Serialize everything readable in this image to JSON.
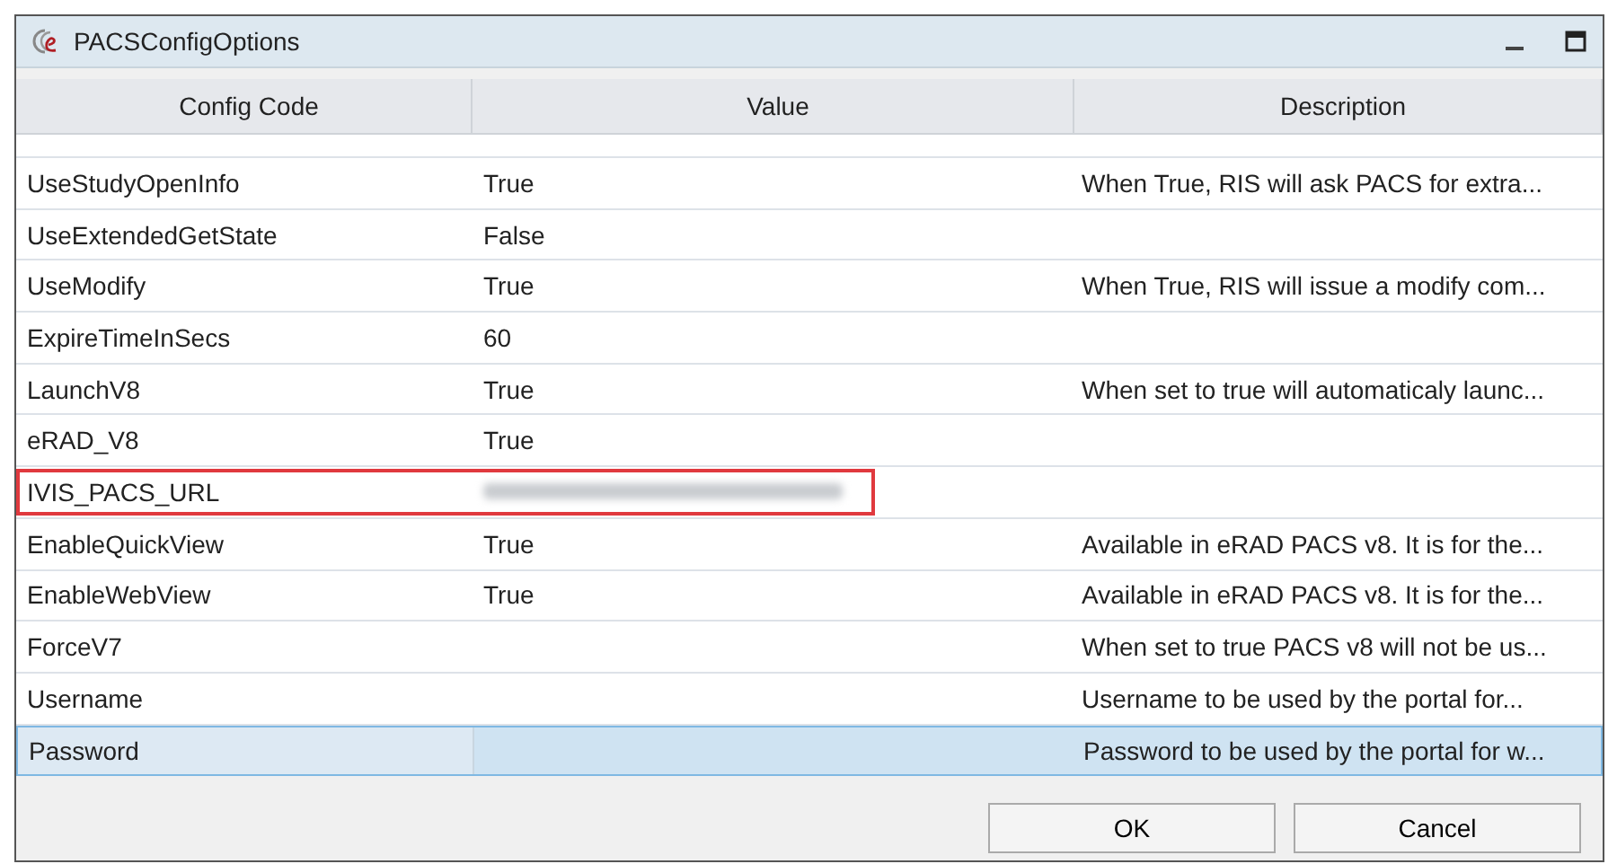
{
  "window": {
    "title": "PACSConfigOptions"
  },
  "table": {
    "columns": [
      "Config Code",
      "Value",
      "Description"
    ],
    "rows": [
      {
        "code": "UseStudyOpenInfo",
        "value": "True",
        "description": "When True, RIS will ask PACS for extra...",
        "selected": false,
        "outlined": false,
        "value_redacted": false
      },
      {
        "code": "UseExtendedGetState",
        "value": "False",
        "description": "",
        "selected": false,
        "outlined": false,
        "value_redacted": false
      },
      {
        "code": "UseModify",
        "value": "True",
        "description": "When True, RIS will issue a modify com...",
        "selected": false,
        "outlined": false,
        "value_redacted": false
      },
      {
        "code": "ExpireTimeInSecs",
        "value": "60",
        "description": "",
        "selected": false,
        "outlined": false,
        "value_redacted": false
      },
      {
        "code": "LaunchV8",
        "value": "True",
        "description": "When set to true will automaticaly launc...",
        "selected": false,
        "outlined": false,
        "value_redacted": false
      },
      {
        "code": "eRAD_V8",
        "value": "True",
        "description": "",
        "selected": false,
        "outlined": false,
        "value_redacted": false
      },
      {
        "code": "IVIS_PACS_URL",
        "value": "",
        "description": "",
        "selected": false,
        "outlined": true,
        "value_redacted": true
      },
      {
        "code": "EnableQuickView",
        "value": "True",
        "description": "Available in eRAD PACS v8. It is for the...",
        "selected": false,
        "outlined": false,
        "value_redacted": false
      },
      {
        "code": "EnableWebView",
        "value": "True",
        "description": "Available in eRAD PACS v8. It is for the...",
        "selected": false,
        "outlined": false,
        "value_redacted": false
      },
      {
        "code": "ForceV7",
        "value": "",
        "description": "When set to true PACS v8 will not be us...",
        "selected": false,
        "outlined": false,
        "value_redacted": false
      },
      {
        "code": "Username",
        "value": "",
        "description": "Username to be used by the portal for...",
        "selected": false,
        "outlined": false,
        "value_redacted": false
      },
      {
        "code": "Password",
        "value": "",
        "description": "Password to be used by the portal for w...",
        "selected": true,
        "outlined": false,
        "value_redacted": false
      }
    ]
  },
  "buttons": [
    "OK",
    "Cancel"
  ]
}
